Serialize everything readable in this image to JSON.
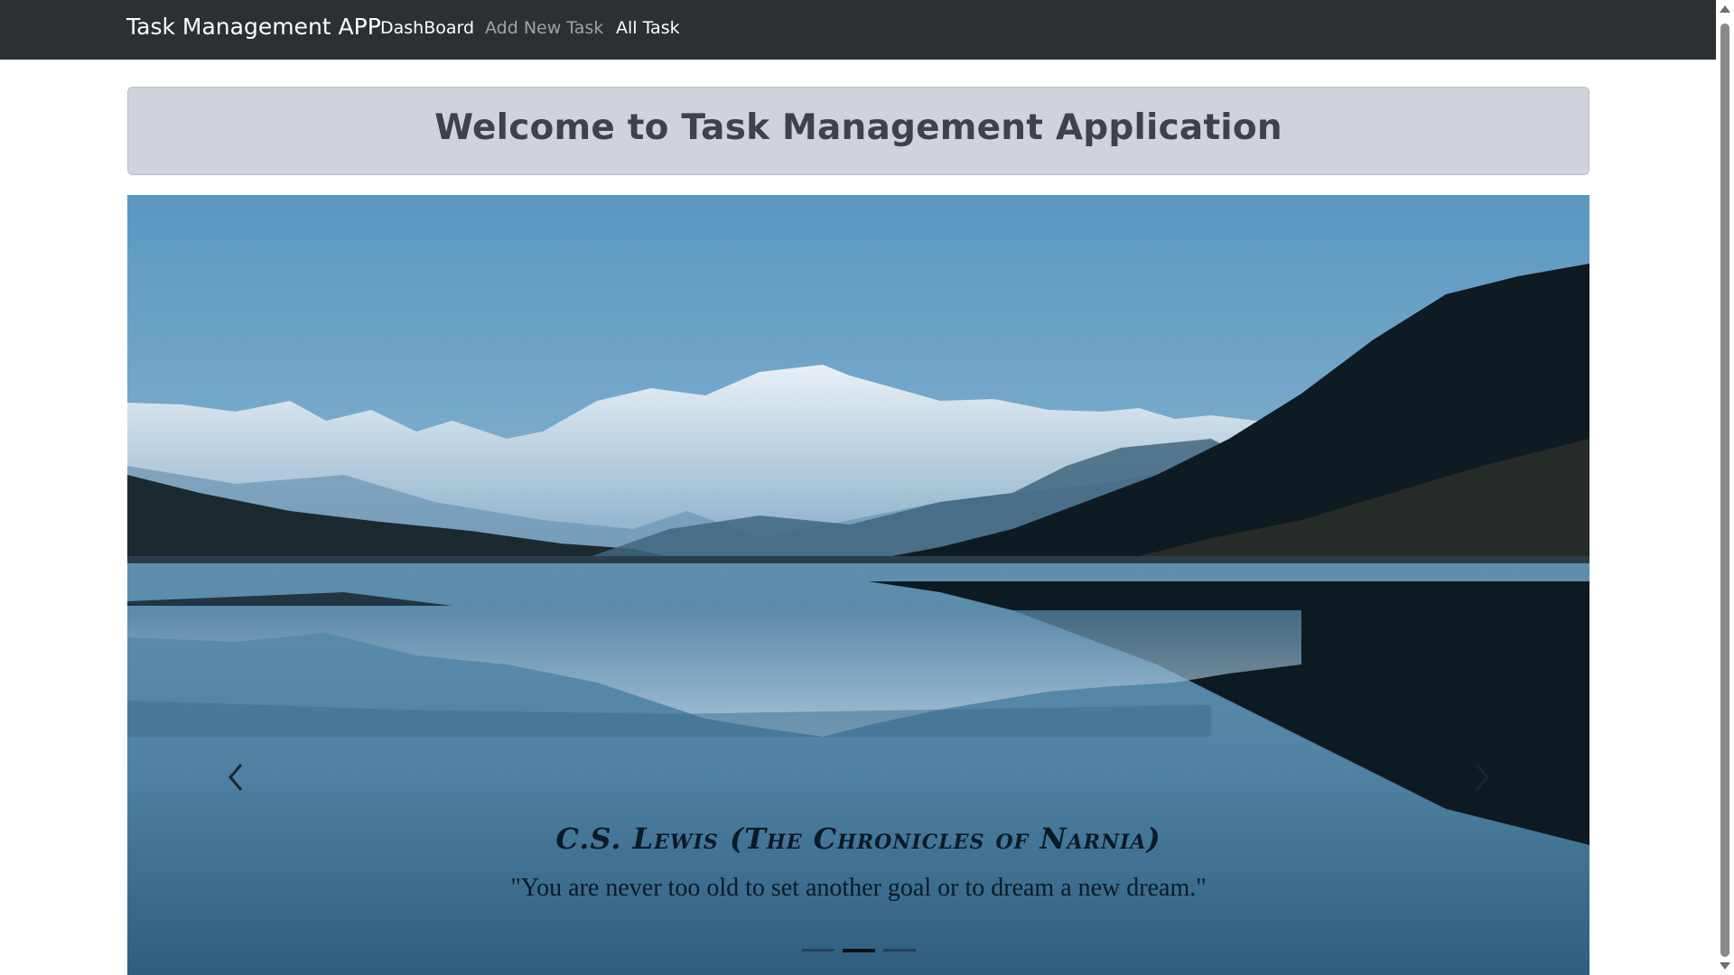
{
  "navbar": {
    "brand": "Task Management APP",
    "links": {
      "dashboard": "DashBoard",
      "add_new_task": "Add New Task",
      "all_task": "All Task"
    },
    "colors": {
      "background": "#2b3035",
      "link_active": "#ffffff",
      "link_muted": "#9ea3a8"
    }
  },
  "welcome": {
    "heading": "Welcome to Task Management Application",
    "background": "#d0d4da"
  },
  "carousel": {
    "image": "mountain-lake-reflection",
    "caption_title": "C.S. Lewis (The Chronicles of Narnia)",
    "caption_quote": "\"You are never too old to set another goal or to dream a new dream.\"",
    "controls": {
      "prev_icon": "chevron-left-icon",
      "next_icon": "chevron-right-icon"
    },
    "indicators": {
      "count": 3,
      "active_index": 1
    }
  }
}
